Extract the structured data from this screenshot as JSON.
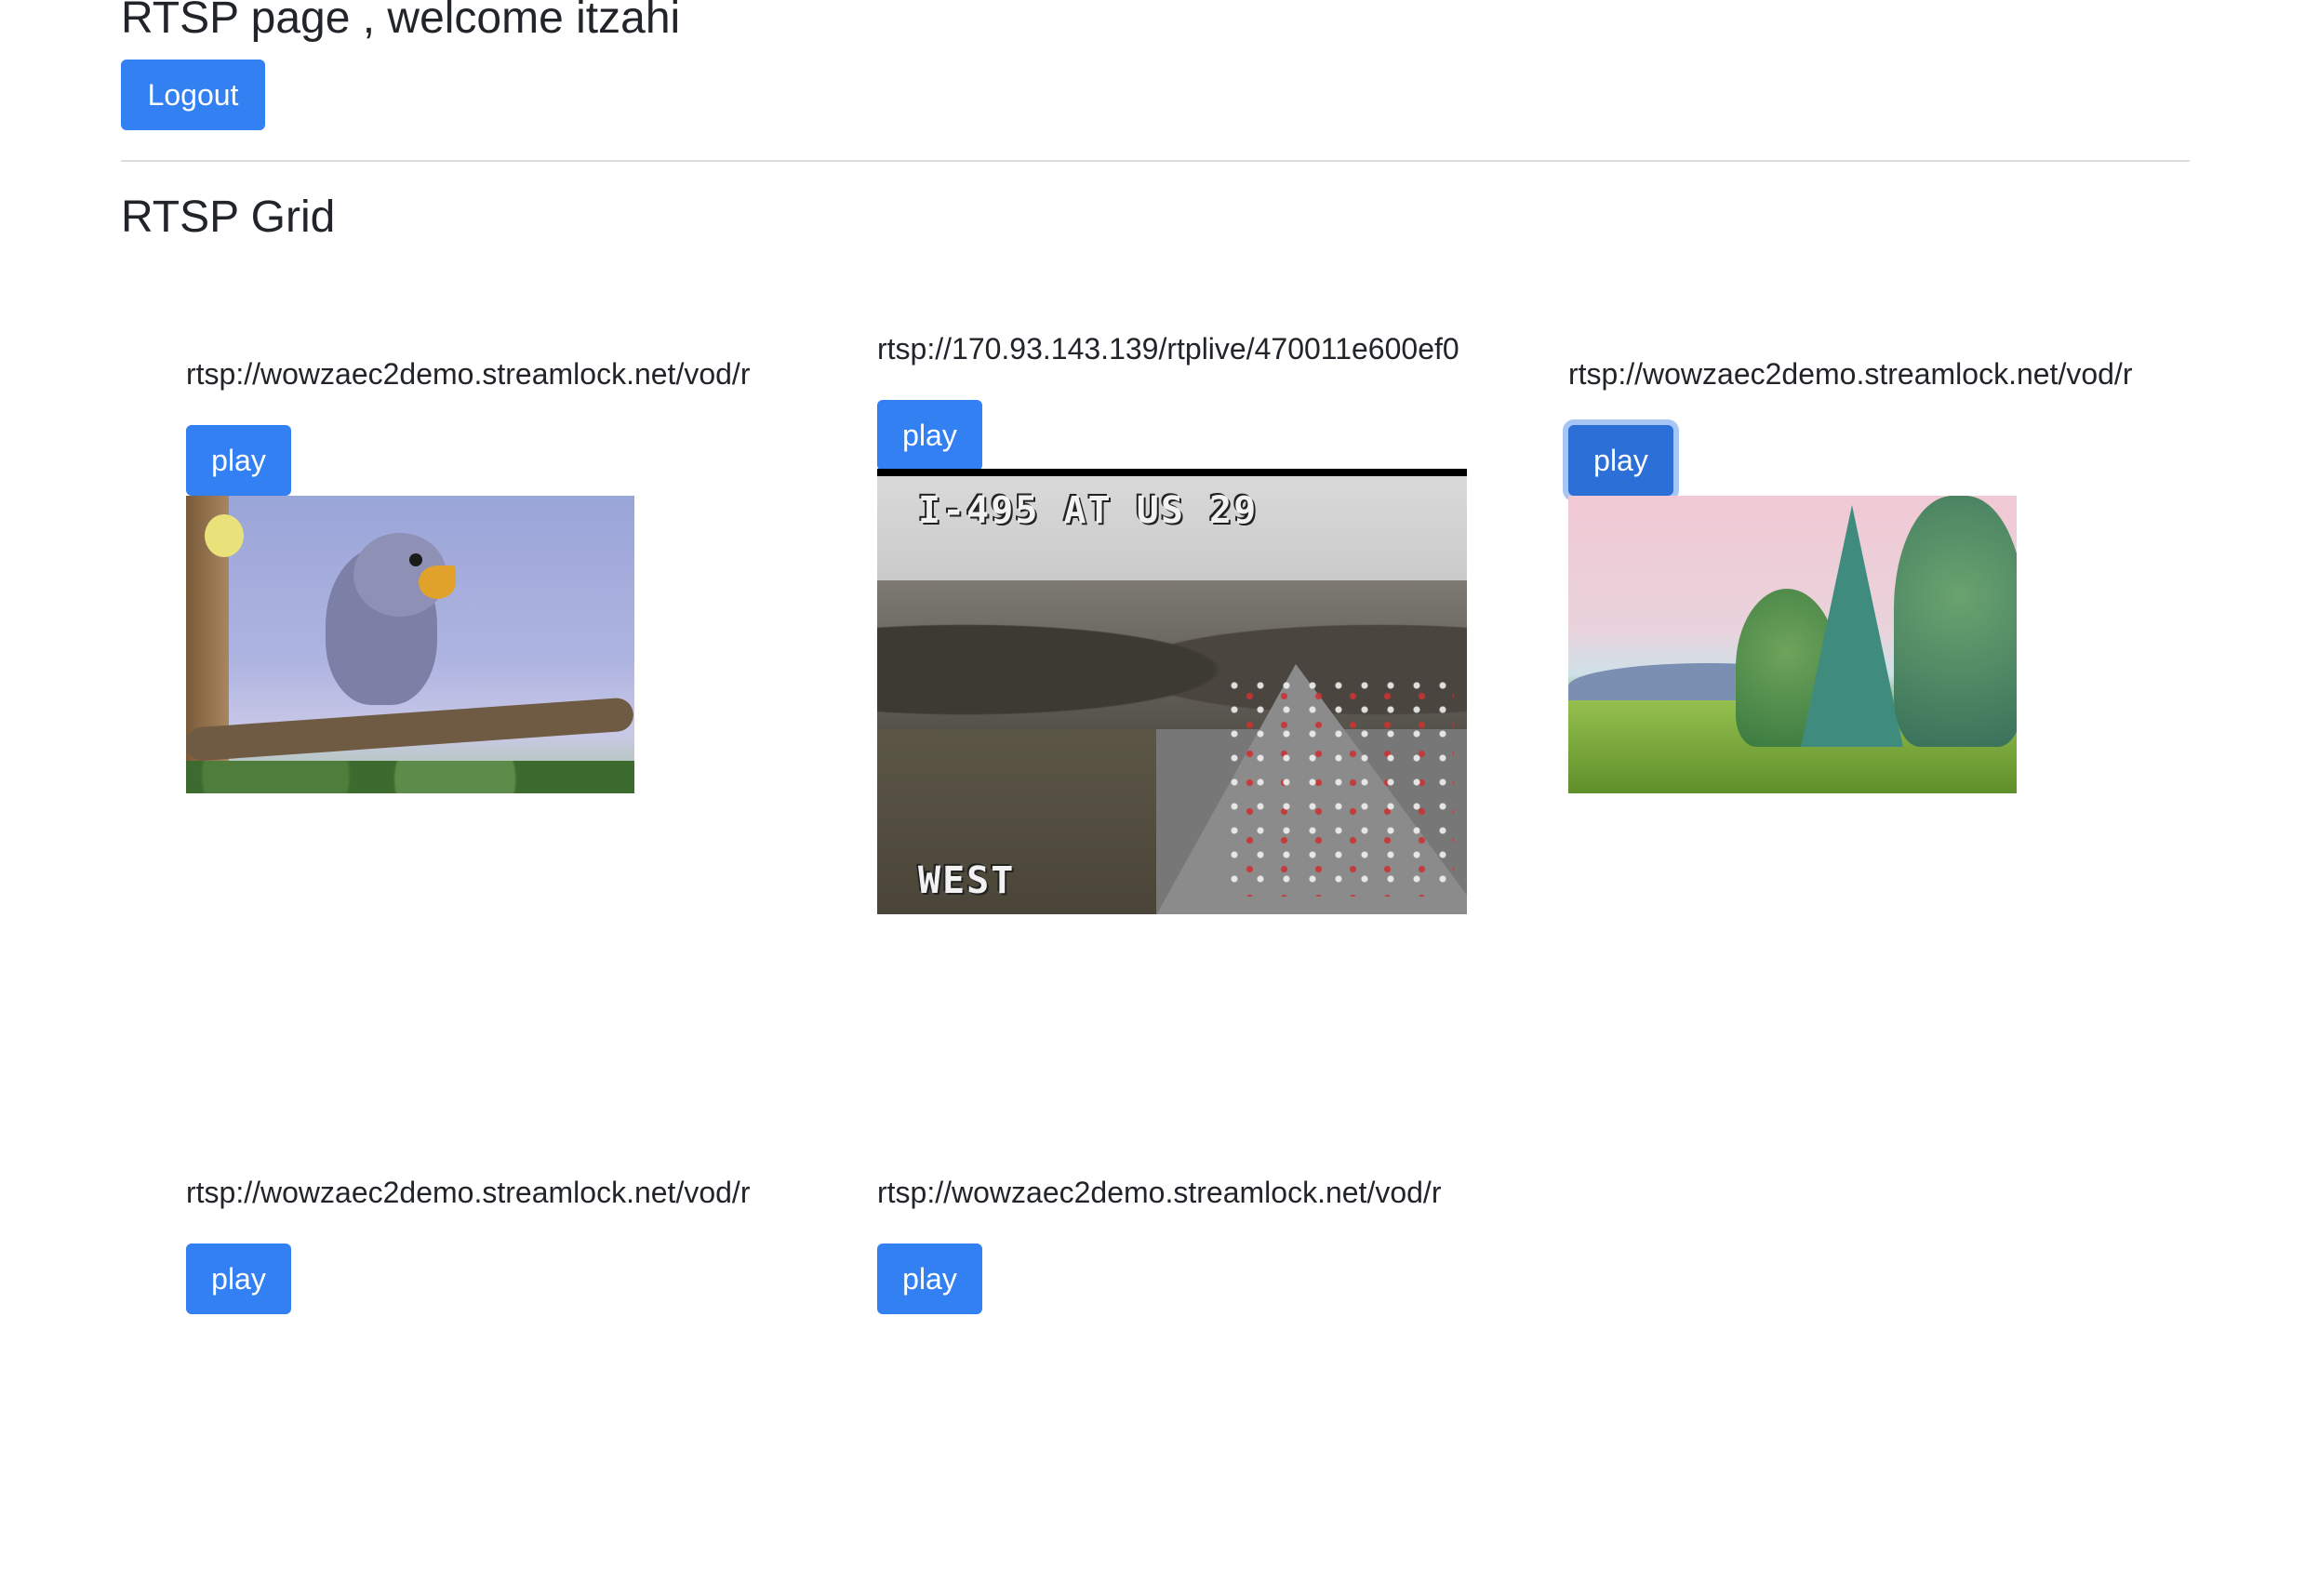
{
  "header": {
    "title": "RTSP page , welcome itzahi",
    "logout_label": "Logout"
  },
  "grid": {
    "title": "RTSP Grid",
    "play_label": "play",
    "streams": [
      {
        "url": "rtsp://wowzaec2demo.streamlock.net/vod/r",
        "playing": true
      },
      {
        "url": "rtsp://170.93.143.139/rtplive/470011e600ef0",
        "playing": true,
        "overlay_top": "I-495 AT US 29",
        "overlay_bottom": "WEST"
      },
      {
        "url": "rtsp://wowzaec2demo.streamlock.net/vod/r",
        "playing": true
      },
      {
        "url": "rtsp://wowzaec2demo.streamlock.net/vod/r",
        "playing": false
      },
      {
        "url": "rtsp://wowzaec2demo.streamlock.net/vod/r",
        "playing": false
      }
    ]
  },
  "colors": {
    "primary": "#3380f2",
    "text": "#212529"
  }
}
